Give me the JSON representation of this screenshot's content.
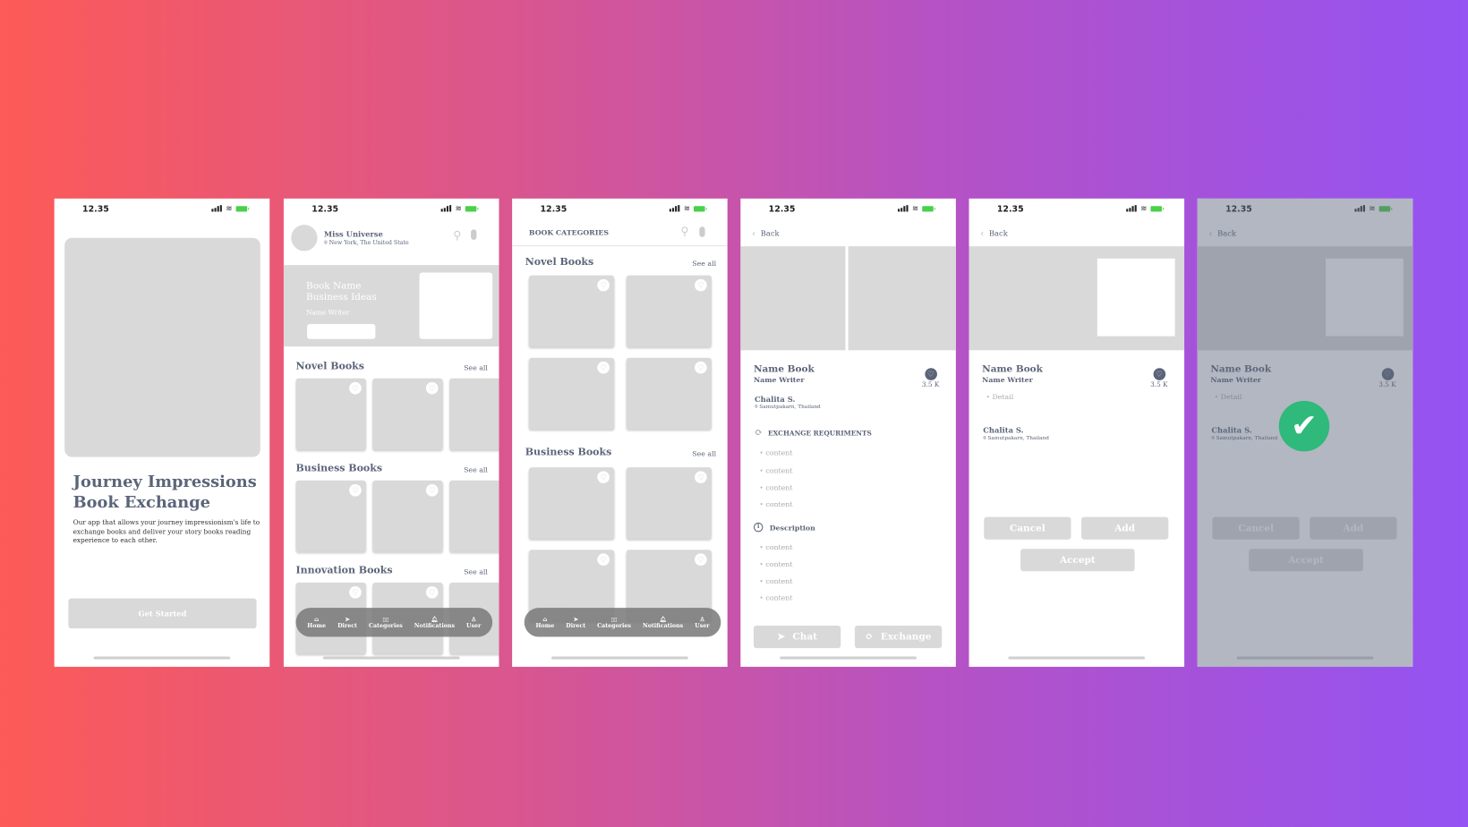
{
  "status": {
    "time": "12.35"
  },
  "onboarding": {
    "title_line1": "Journey Impressions",
    "title_line2": "Book Exchange",
    "description": "Our app that allows your journey impressionism's life to exchange books and deliver your story books reading experience to each other.",
    "cta": "Get Started"
  },
  "home": {
    "user_name": "Miss Universe",
    "user_location": "New York, The United State",
    "banner": {
      "line1": "Book Name",
      "line2": "Business Ideas",
      "writer": "Name Writer"
    },
    "sections": [
      "Novel Books",
      "Business Books",
      "Innovation Books"
    ],
    "see_all": "See all"
  },
  "categories": {
    "title": "BOOK CATEGORIES",
    "sections": [
      "Novel Books",
      "Business Books"
    ],
    "see_all": "See all"
  },
  "nav": [
    {
      "label": "Home",
      "icon": "home-icon"
    },
    {
      "label": "Direct",
      "icon": "send-icon"
    },
    {
      "label": "Categories",
      "icon": "book-icon"
    },
    {
      "label": "Notifications",
      "icon": "bell-icon"
    },
    {
      "label": "User",
      "icon": "user-icon"
    }
  ],
  "detail": {
    "back": "Back",
    "name_book": "Name Book",
    "name_writer": "Name Writer",
    "likes": "3.5 K",
    "owner": "Chalita S.",
    "owner_location": "Samutpakarn, Thailand",
    "exchange_title": "EXCHANGE REQURIMENTS",
    "exchange_items": [
      "content",
      "content",
      "content",
      "content"
    ],
    "description_title": "Description",
    "description_items": [
      "content",
      "content",
      "content",
      "content"
    ],
    "chat": "Chat",
    "exchange": "Exchange"
  },
  "request": {
    "detail": "Detail",
    "cancel": "Cancel",
    "add": "Add",
    "accept": "Accept"
  },
  "colors": {
    "text": "#5b6479",
    "placeholder": "#d9d9d9",
    "success": "#2fb97a"
  }
}
